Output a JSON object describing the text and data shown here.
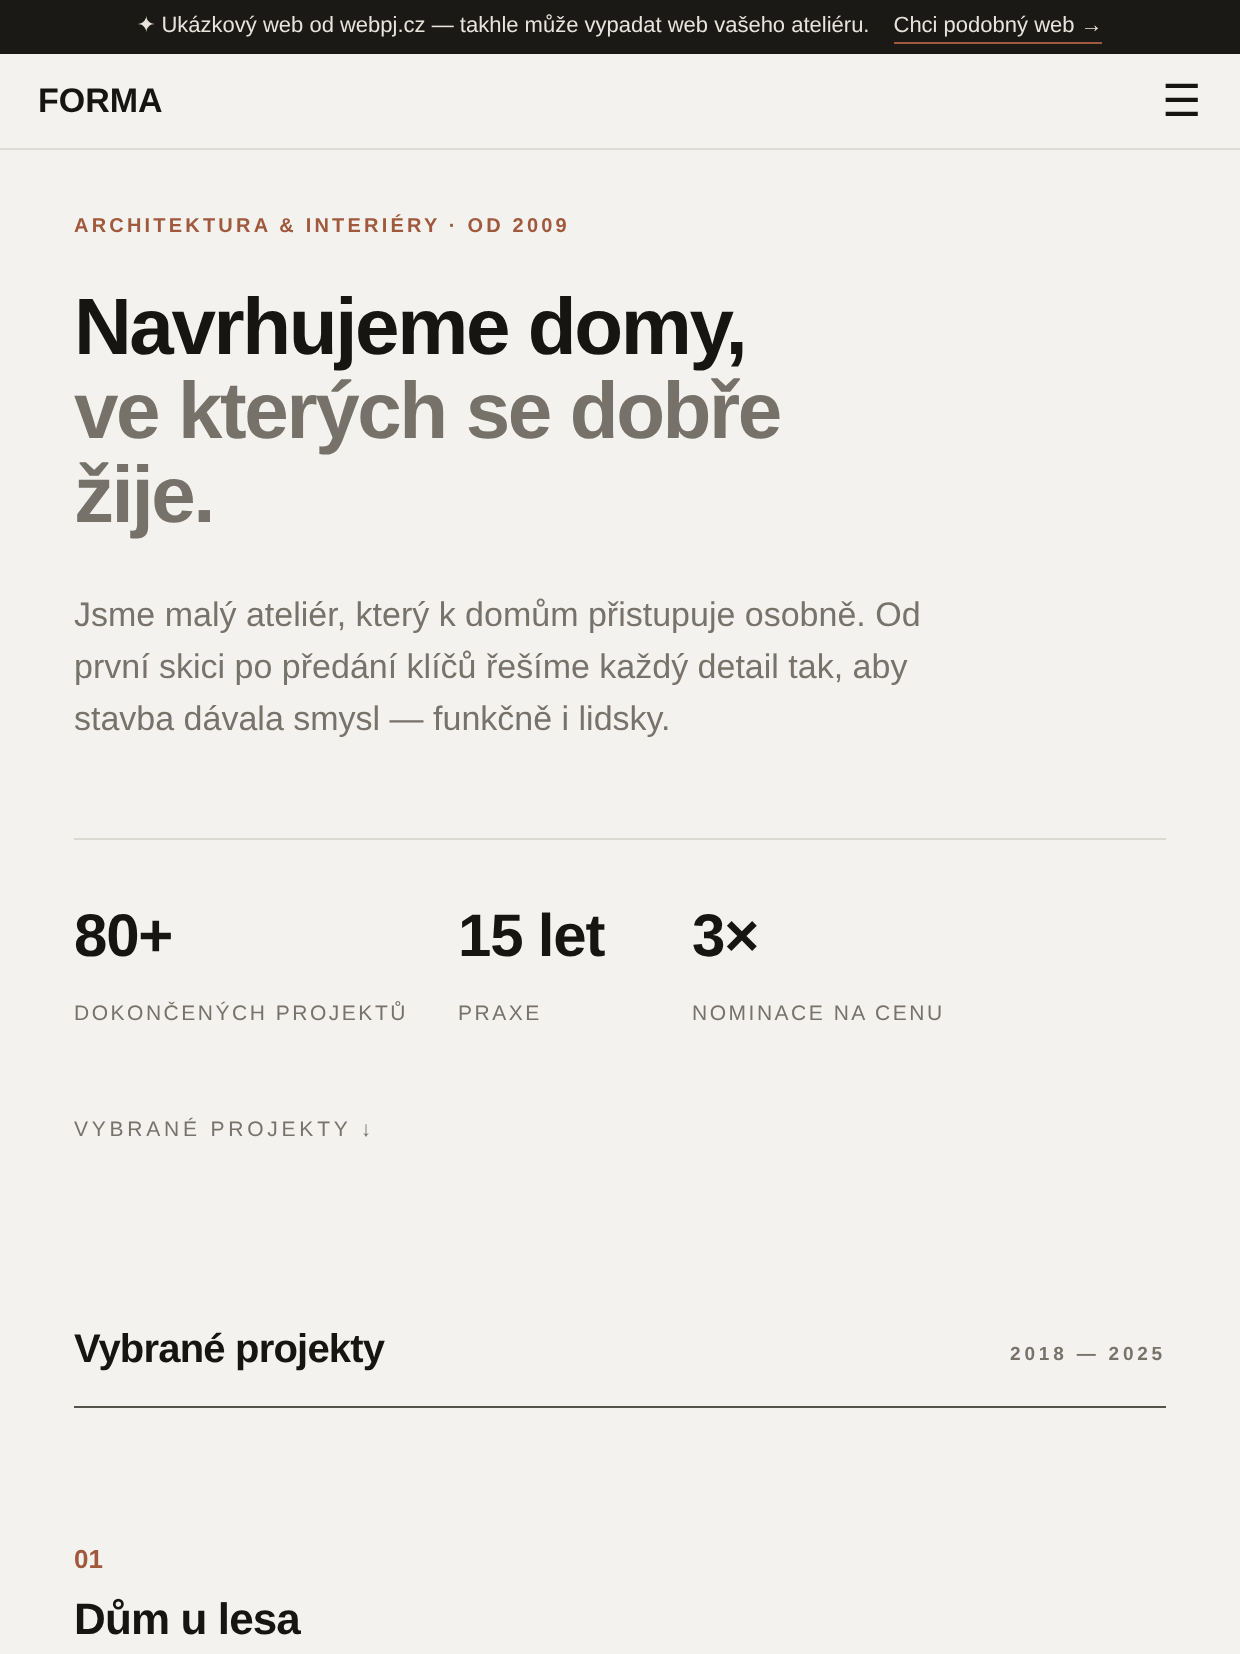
{
  "banner": {
    "text": "✦ Ukázkový web od webpj.cz — takhle může vypadat web vašeho ateliéru.",
    "link": "Chci podobný web →"
  },
  "header": {
    "logo": "FORMA",
    "menu_icon": "☰"
  },
  "hero": {
    "eyebrow": "ARCHITEKTURA & INTERIÉRY · OD 2009",
    "headline": [
      {
        "text": "Navrhujeme domy,",
        "kind": "dark"
      },
      {
        "text": "ve kterých se dobře žije.",
        "kind": "muted"
      }
    ],
    "intro": "Jsme malý ateliér, který k domům přistupuje osobně. Od první skici po předání klíčů řešíme každý detail tak, aby stavba dávala smysl — funkčně i lidsky."
  },
  "stats": [
    {
      "value": "80+",
      "label": "DOKONČENÝCH PROJEKTŮ"
    },
    {
      "value": "15 let",
      "label": "PRAXE"
    },
    {
      "value": "3×",
      "label": "NOMINACE NA CENU"
    }
  ],
  "scroll_link": "VYBRANÉ PROJEKTY ↓",
  "projects": {
    "title": "Vybrané projekty",
    "years": "2018 — 2025",
    "items": [
      {
        "number": "01",
        "name": "Dům u lesa"
      }
    ]
  }
}
